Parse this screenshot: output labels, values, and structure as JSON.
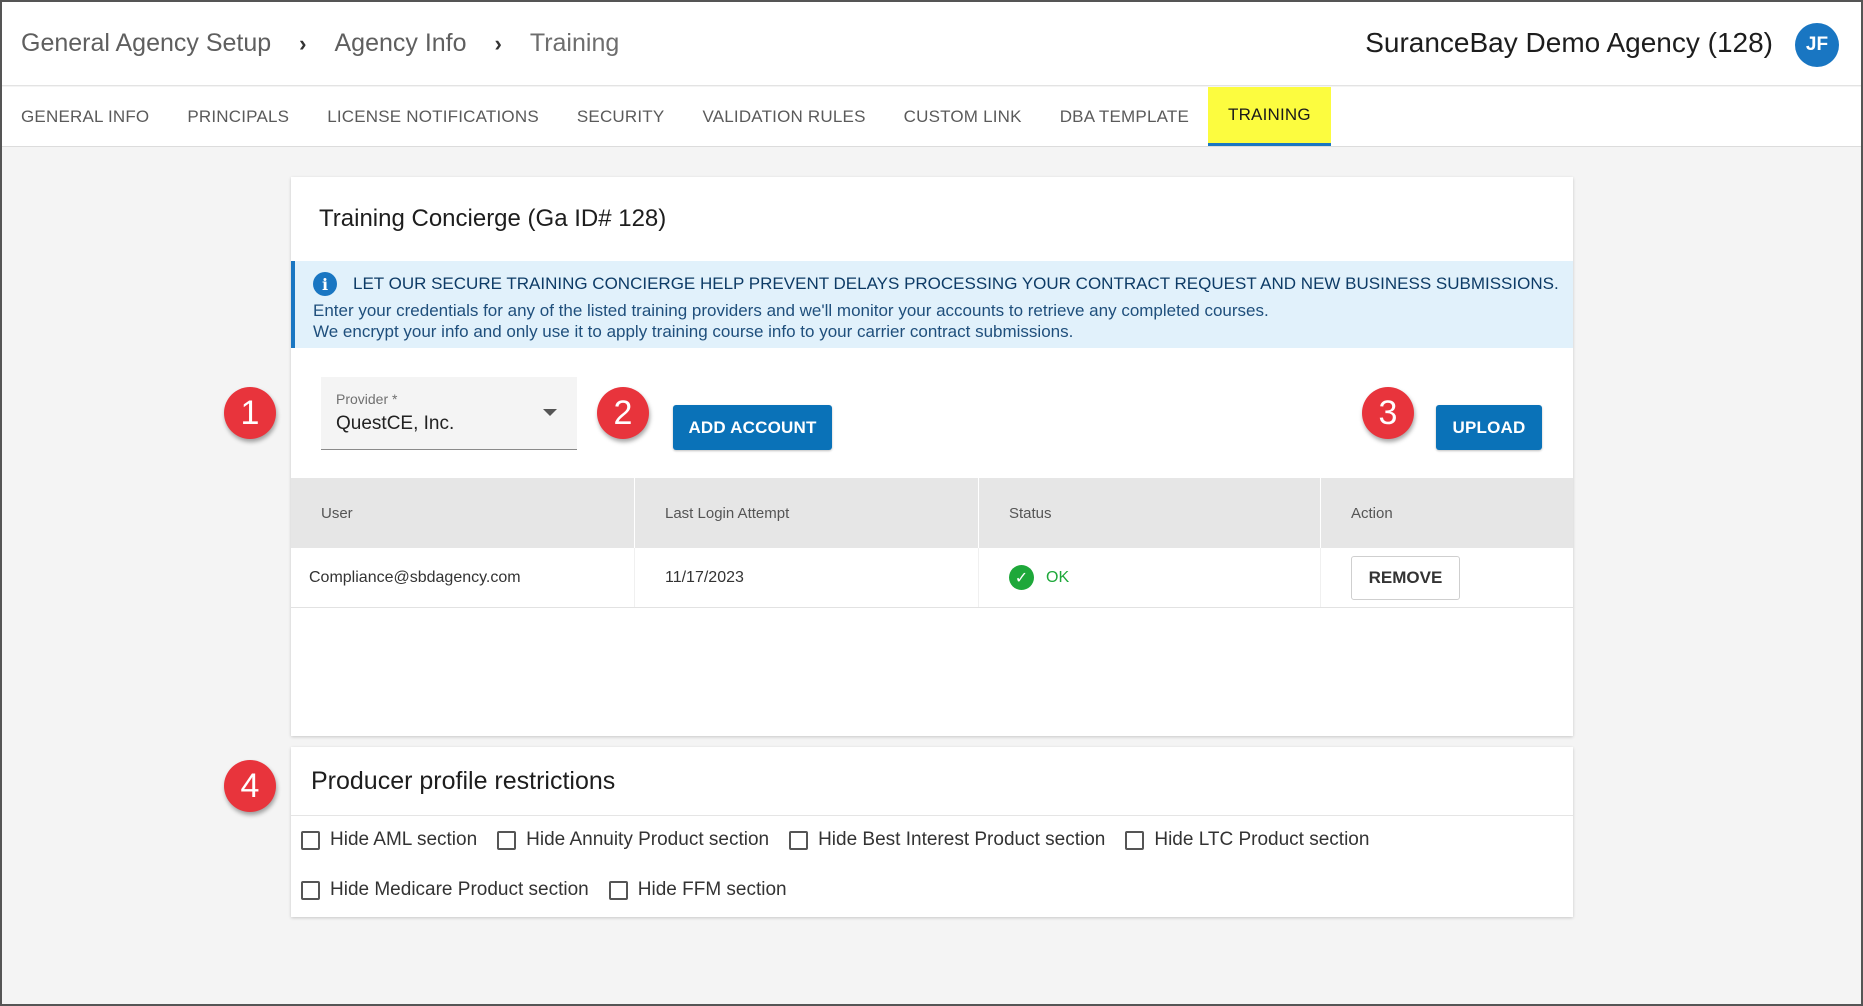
{
  "breadcrumb": [
    "General Agency Setup",
    "Agency Info",
    "Training"
  ],
  "breadcrumb_separator": "›",
  "agency_name": "SuranceBay Demo Agency (128)",
  "user_initials": "JF",
  "tabs": [
    {
      "label": "GENERAL INFO",
      "active": false
    },
    {
      "label": "PRINCIPALS",
      "active": false
    },
    {
      "label": "LICENSE NOTIFICATIONS",
      "active": false
    },
    {
      "label": "SECURITY",
      "active": false
    },
    {
      "label": "VALIDATION RULES",
      "active": false
    },
    {
      "label": "CUSTOM LINK",
      "active": false
    },
    {
      "label": "DBA TEMPLATE",
      "active": false
    },
    {
      "label": "TRAINING",
      "active": true
    }
  ],
  "training": {
    "title": "Training Concierge (Ga ID# 128)",
    "info_icon": "i",
    "info_heading": "LET OUR SECURE TRAINING CONCIERGE HELP PREVENT DELAYS PROCESSING YOUR CONTRACT REQUEST AND NEW BUSINESS SUBMISSIONS.",
    "info_line1": "Enter your credentials for any of the listed training providers and we'll monitor your accounts to retrieve any completed courses.",
    "info_line2": "We encrypt your info and only use it to apply training course info to your carrier contract submissions.",
    "provider_label": "Provider *",
    "provider_value": "QuestCE, Inc.",
    "add_account_label": "ADD ACCOUNT",
    "upload_label": "UPLOAD",
    "columns": [
      "User",
      "Last Login Attempt",
      "Status",
      "Action"
    ],
    "rows": [
      {
        "user": "Compliance@sbdagency.com",
        "last_login": "11/17/2023",
        "status": "OK",
        "action": "REMOVE"
      }
    ]
  },
  "restrictions": {
    "title": "Producer profile restrictions",
    "row1": [
      "Hide AML section",
      "Hide Annuity Product section",
      "Hide Best Interest Product section",
      "Hide LTC Product section"
    ],
    "row2": [
      "Hide Medicare Product section",
      "Hide FFM section"
    ]
  },
  "markers": [
    "1",
    "2",
    "3",
    "4"
  ],
  "colors": {
    "accent": "#1976c2",
    "button": "#0a72b8",
    "active_tab_bg": "#fcfc3f",
    "info_bg": "#e1f1fb",
    "ok": "#1ea83a",
    "marker": "#e8343c"
  }
}
